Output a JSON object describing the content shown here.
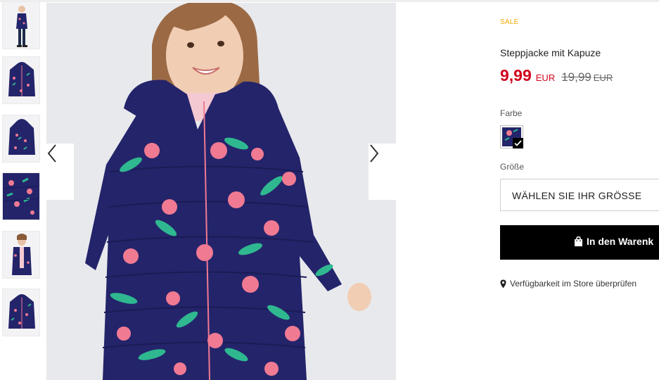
{
  "product": {
    "sale_badge": "SALE",
    "title": "Steppjacke mit Kapuze",
    "price_current": "9,99",
    "currency_current": "EUR",
    "price_original": "19,99",
    "currency_original": "EUR",
    "color_label": "Farbe",
    "selected_color": "navy floral",
    "size_label": "Größe",
    "size_placeholder": "WÄHLEN SIE IHR GRÖSSE",
    "add_to_cart_label": "In den Warenk",
    "store_availability_label": "Verfügbarkeit im Store überprüfen"
  },
  "gallery": {
    "thumbnail_count": 6,
    "prev_icon": "chevron-left-icon",
    "next_icon": "chevron-right-icon"
  },
  "colors": {
    "sale": "#f2a900",
    "price": "#d0021b",
    "old_price": "#666666",
    "jacket_navy": "#24246b",
    "leaf_green": "#2fb88f",
    "flower_pink": "#f07a92",
    "button_bg": "#000000"
  },
  "icons": {
    "cart": "shopping-bag-icon",
    "store": "map-pin-icon",
    "check": "check-icon"
  }
}
